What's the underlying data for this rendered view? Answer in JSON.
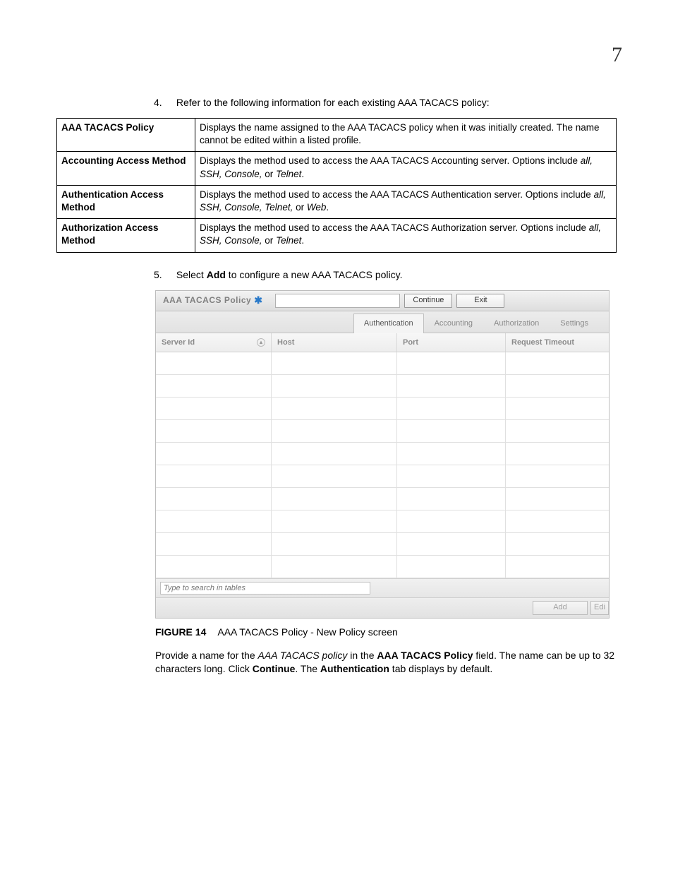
{
  "page_number": "7",
  "step4": {
    "num": "4.",
    "text": "Refer to the following information for each existing AAA TACACS policy:"
  },
  "def_rows": [
    {
      "k": "AAA TACACS Policy",
      "v_pre": "Displays the name assigned to the AAA TACACS policy when it was initially created. The name cannot be edited within a listed profile."
    },
    {
      "k": "Accounting Access Method",
      "v_pre": "Displays the method used to access the AAA TACACS Accounting server. Options include ",
      "opts": "all, SSH, Console,",
      "mid": " or ",
      "opts2": "Telnet",
      "post": "."
    },
    {
      "k": "Authentication Access Method",
      "v_pre": "Displays the method used to access the AAA TACACS Authentication server. Options include ",
      "opts": "all, SSH, Console, Telnet,",
      "mid": " or ",
      "opts2": "Web",
      "post": "."
    },
    {
      "k": "Authorization Access Method",
      "v_pre": "Displays the method used to access the AAA TACACS Authorization server. Options include ",
      "opts": "all, SSH, Console,",
      "mid": " or ",
      "opts2": "Telnet",
      "post": "."
    }
  ],
  "step5": {
    "num": "5.",
    "pre": "Select ",
    "bold": "Add",
    "post": " to configure a new AAA TACACS policy."
  },
  "ui": {
    "title": "AAA TACACS Policy",
    "btn_continue": "Continue",
    "btn_exit": "Exit",
    "tabs": [
      "Authentication",
      "Accounting",
      "Authorization",
      "Settings"
    ],
    "grid_cols": {
      "id": "Server Id",
      "host": "Host",
      "port": "Port",
      "rt": "Request Timeout"
    },
    "search_placeholder": "Type to search in tables",
    "btn_add": "Add",
    "btn_edit": "Edi"
  },
  "figure": {
    "num": "FIGURE 14",
    "caption": "AAA TACACS Policy - New Policy screen"
  },
  "para": {
    "p1": "Provide a name for the ",
    "i1": "AAA TACACS policy",
    "p2": " in the ",
    "b1": "AAA TACACS Policy",
    "p3": " field. The name can be up to 32 characters long. Click ",
    "b2": "Continue",
    "p4": ". The ",
    "b3": "Authentication",
    "p5": " tab displays by default."
  }
}
